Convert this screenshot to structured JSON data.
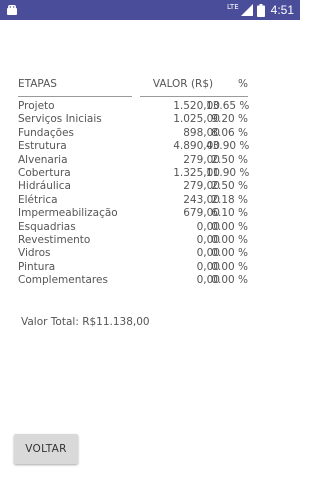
{
  "status_bar": {
    "network": "LTE",
    "time": "4:51",
    "color": "#4a4e9a"
  },
  "table": {
    "headers": {
      "etapas": "ETAPAS",
      "valor": "VALOR (R$)",
      "pct": "%"
    },
    "rows": [
      {
        "etapa": "Projeto",
        "valor": "1.520,00",
        "pct": "13.65 %"
      },
      {
        "etapa": "Serviços Iniciais",
        "valor": "1.025,00",
        "pct": "9.20 %"
      },
      {
        "etapa": "Fundações",
        "valor": "898,00",
        "pct": "8.06 %"
      },
      {
        "etapa": "Estrutura",
        "valor": "4.890,00",
        "pct": "43.90 %"
      },
      {
        "etapa": "Alvenaria",
        "valor": "279,00",
        "pct": "2.50 %"
      },
      {
        "etapa": "Cobertura",
        "valor": "1.325,00",
        "pct": "11.90 %"
      },
      {
        "etapa": "Hidráulica",
        "valor": "279,00",
        "pct": "2.50 %"
      },
      {
        "etapa": "Elétrica",
        "valor": "243,00",
        "pct": "2.18 %"
      },
      {
        "etapa": "Impermeabilização",
        "valor": "679,00",
        "pct": "6.10 %"
      },
      {
        "etapa": "Esquadrias",
        "valor": "0,00",
        "pct": "0.00 %"
      },
      {
        "etapa": "Revestimento",
        "valor": "0,00",
        "pct": "0.00 %"
      },
      {
        "etapa": "Vidros",
        "valor": "0,00",
        "pct": "0.00 %"
      },
      {
        "etapa": "Pintura",
        "valor": "0,00",
        "pct": "0.00 %"
      },
      {
        "etapa": "Complementares",
        "valor": "0,00",
        "pct": "0.00 %"
      }
    ]
  },
  "total": {
    "text": "Valor Total: R$11.138,00"
  },
  "buttons": {
    "voltar": "VOLTAR"
  }
}
